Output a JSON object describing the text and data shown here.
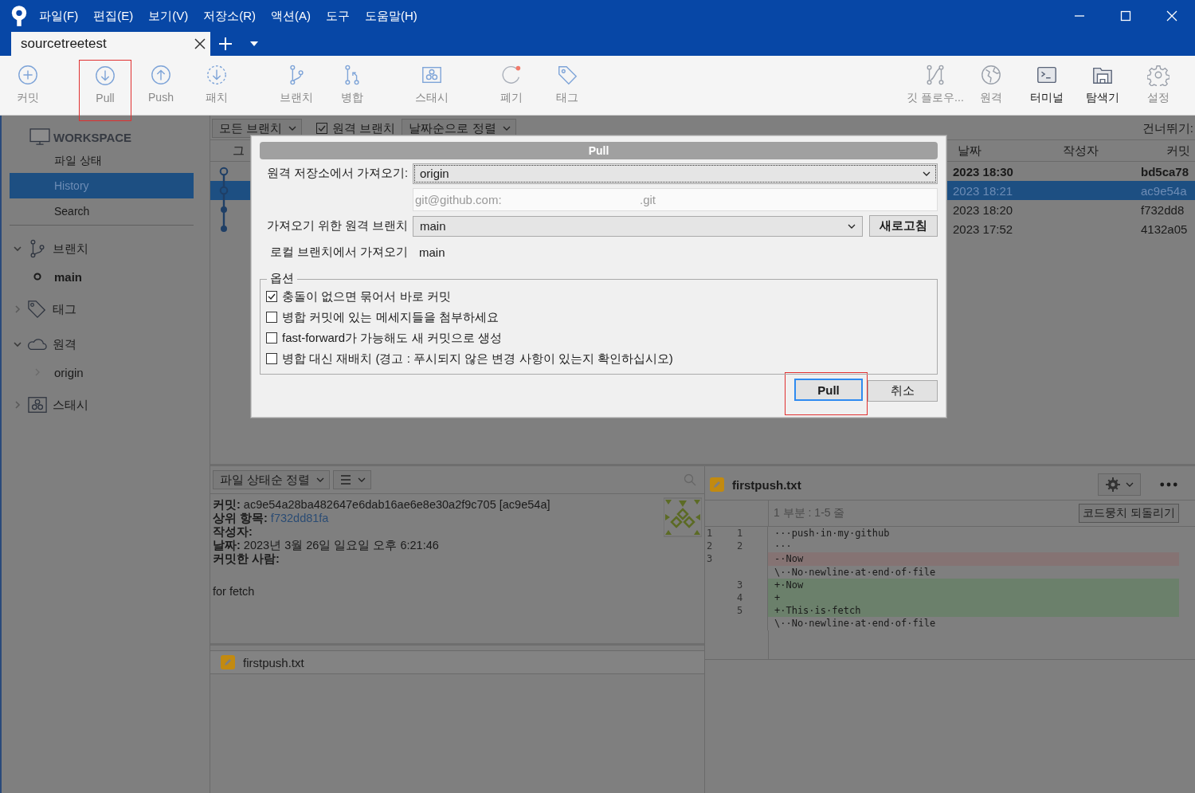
{
  "menu": [
    "파일(F)",
    "편집(E)",
    "보기(V)",
    "저장소(R)",
    "액션(A)",
    "도구",
    "도움말(H)"
  ],
  "tabs": [
    {
      "label": "sourcetreetest",
      "selected": true
    }
  ],
  "toolbar": {
    "left": [
      {
        "label": "커밋",
        "kind": "commit",
        "muted": true,
        "highlighted": false
      },
      {
        "label": "Pull",
        "kind": "pull",
        "muted": true,
        "highlighted": true
      },
      {
        "label": "Push",
        "kind": "push",
        "muted": true,
        "highlighted": false
      },
      {
        "label": "패치",
        "kind": "patch",
        "muted": true,
        "highlighted": false
      },
      {
        "label": "브랜치",
        "kind": "branch",
        "muted": true,
        "highlighted": false
      },
      {
        "label": "병합",
        "kind": "merge",
        "muted": true,
        "highlighted": false
      },
      {
        "label": "스태시",
        "kind": "stash",
        "muted": true,
        "highlighted": false
      },
      {
        "label": "폐기",
        "kind": "discard",
        "muted": true,
        "highlighted": false
      },
      {
        "label": "태그",
        "kind": "tag",
        "muted": true,
        "highlighted": false
      }
    ],
    "right": [
      {
        "label": "깃 플로우...",
        "kind": "gitflow",
        "muted": true,
        "highlighted": false
      },
      {
        "label": "원격",
        "kind": "remote",
        "muted": true,
        "highlighted": false
      },
      {
        "label": "터미널",
        "kind": "terminal",
        "muted": false,
        "highlighted": false
      },
      {
        "label": "탐색기",
        "kind": "explorer",
        "muted": false,
        "highlighted": false
      },
      {
        "label": "설정",
        "kind": "settings",
        "muted": true,
        "highlighted": false
      }
    ]
  },
  "sidebar": {
    "workspace": {
      "title": "WORKSPACE",
      "items": [
        {
          "label": "파일 상태",
          "selected": false
        },
        {
          "label": "History",
          "selected": true
        },
        {
          "label": "Search",
          "selected": false
        }
      ]
    },
    "groups": [
      {
        "label": "브랜치",
        "kind": "branch",
        "expanded": true,
        "children": [
          {
            "label": "main",
            "kind": "branch",
            "current": true
          }
        ]
      },
      {
        "label": "태그",
        "kind": "tag",
        "expanded": false
      },
      {
        "label": "원격",
        "kind": "remote",
        "expanded": true,
        "children": [
          {
            "label": "origin",
            "kind": "remote",
            "current": false
          }
        ]
      },
      {
        "label": "스태시",
        "kind": "stash",
        "expanded": false
      }
    ]
  },
  "history": {
    "branches": "모든 브랜치",
    "remote_branches": {
      "label": "원격 브랜치",
      "checked": true
    },
    "sort": "날짜순으로 정렬",
    "skip_label": "건너뛰기:",
    "columns": [
      "그",
      "날짜",
      "작성자",
      "커밋"
    ],
    "rows": [
      {
        "kind": "ring",
        "date": "2023 18:30",
        "commit": "bd5ca78",
        "bold": true,
        "selected": false
      },
      {
        "kind": "ring",
        "date": "2023 18:21",
        "commit": "ac9e54a",
        "bold": false,
        "selected": true
      },
      {
        "kind": "dot",
        "date": "2023 18:20",
        "commit": "f732dd8",
        "bold": false,
        "selected": false
      },
      {
        "kind": "dot",
        "date": "2023 17:52",
        "commit": "4132a05",
        "bold": false,
        "selected": false
      }
    ]
  },
  "dialog": {
    "title": "Pull",
    "remote_label": "원격 저장소에서 가져오기:",
    "remote": "origin",
    "url_prefix": "git@github.com:",
    "url_suffix": ".git",
    "branch_label": "가져오기 위한 원격 브랜치",
    "branch": "main",
    "refresh": "새로고침",
    "local_label": "로컬 브랜치에서 가져오기",
    "local": "main",
    "options_title": "옵션",
    "options": [
      {
        "label": "충돌이 없으면 묶어서 바로 커밋",
        "checked": true
      },
      {
        "label": "병합 커밋에 있는 메세지들을 첨부하세요",
        "checked": false
      },
      {
        "label": "fast-forward가 가능해도 새 커밋으로 생성",
        "checked": false
      },
      {
        "label": "병합 대신 재배치 (경고 : 푸시되지 않은 변경 사항이 있는지 확인하십시오)",
        "checked": false
      }
    ],
    "buttons": [
      {
        "label": "Pull",
        "default": true,
        "highlighted": true
      },
      {
        "label": "취소",
        "default": false,
        "highlighted": false
      }
    ]
  },
  "details": {
    "sort": "파일 상태순 정렬",
    "fields": [
      {
        "label": "커밋:",
        "value": "ac9e54a28ba482647e6dab16ae6e8e30a2f9c705 [ac9e54a]",
        "link": false
      },
      {
        "label": "상위 항목:",
        "value": "f732dd81fa",
        "link": true
      },
      {
        "label": "작성자:"
      },
      {
        "label": "날짜:",
        "value": "2023년 3월 26일 일요일 오후 6:21:46",
        "link": false
      },
      {
        "label": "커밋한 사람:"
      }
    ],
    "message": "for fetch",
    "files": [
      {
        "name": "firstpush.txt",
        "selected": true
      }
    ]
  },
  "diff": {
    "file": "firstpush.txt",
    "hunk": "1 부분 : 1-5 줄",
    "revert": "코드뭉치 되돌리기",
    "lines": [
      {
        "old": "1",
        "new": "1",
        "kind": "context",
        "text": "···push·in·my·github"
      },
      {
        "old": "2",
        "new": "2",
        "kind": "context",
        "text": "···"
      },
      {
        "old": "3",
        "kind": "removed",
        "text": "-·Now"
      },
      {
        "kind": "meta",
        "text": "\\··No·newline·at·end·of·file"
      },
      {
        "new": "3",
        "kind": "added",
        "text": "+·Now"
      },
      {
        "new": "4",
        "kind": "added",
        "text": "+"
      },
      {
        "new": "5",
        "kind": "added",
        "text": "+·This·is·fetch"
      },
      {
        "kind": "meta",
        "text": "\\··No·newline·at·end·of·file"
      }
    ]
  }
}
